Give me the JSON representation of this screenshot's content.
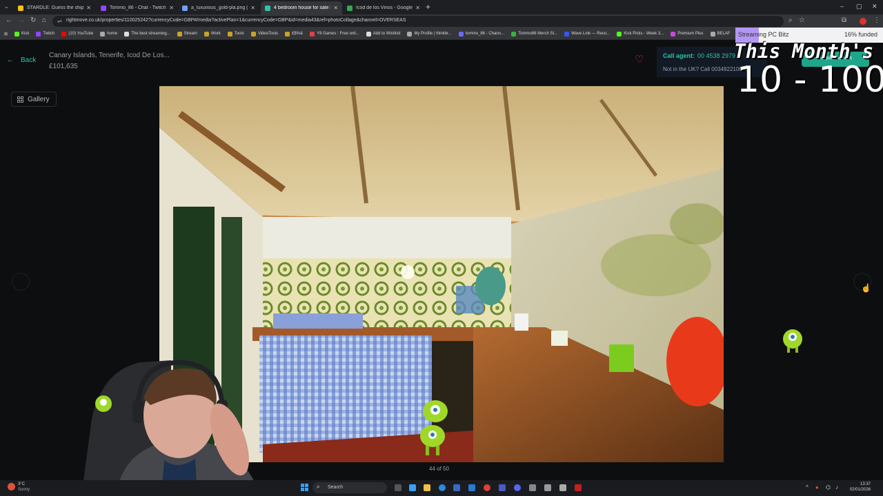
{
  "browser": {
    "tabs": [
      {
        "title": "STARDLE: Guess the ship!",
        "color": "#f0c419"
      },
      {
        "title": "Tommo_86 - Chat - Twitch",
        "color": "#9146ff"
      },
      {
        "title": "a_luxurious_gold-pla.png (960×",
        "color": "#6aa0ff"
      },
      {
        "title": "4 bedroom house for sale in Ca",
        "color": "#2dc5a6",
        "active": true
      },
      {
        "title": "Icod de los Vinos - Google Ma",
        "color": "#34a853"
      }
    ],
    "url": "rightmove.co.uk/properties/110025242?currencyCode=GBP#/media?activePlan=1&currencyCode=GBP&id=media43&ref=photoCollage&channel=OVERSEAS",
    "bookmarks": [
      {
        "label": "Kick",
        "color": "#53fc18"
      },
      {
        "label": "Twitch",
        "color": "#9146ff"
      },
      {
        "label": "(10) YouTube",
        "color": "#ff0000"
      },
      {
        "label": "home",
        "color": "#aaaaaa"
      },
      {
        "label": "The best streaming...",
        "color": "#dddddd"
      },
      {
        "label": "Stream",
        "color": "#c9a227"
      },
      {
        "label": "Work",
        "color": "#c9a227"
      },
      {
        "label": "Tools",
        "color": "#c9a227"
      },
      {
        "label": "VideoTools",
        "color": "#c9a227"
      },
      {
        "label": "£$%&",
        "color": "#c9a227"
      },
      {
        "label": "Y8 Games : Free onli...",
        "color": "#e04040"
      },
      {
        "label": "Add to Wishlist",
        "color": "#dddddd"
      },
      {
        "label": "My Profile | thinkbr...",
        "color": "#aaaaaa"
      },
      {
        "label": "tommo_86 - Chann...",
        "color": "#6a6aff"
      },
      {
        "label": "Tommo86 Merch St...",
        "color": "#3cb043"
      },
      {
        "label": "Wave Link — Reco...",
        "color": "#3355ff"
      },
      {
        "label": "Kick Picks - Week 3...",
        "color": "#53fc18"
      },
      {
        "label": "Premium Plus",
        "color": "#c64ad8"
      },
      {
        "label": "BELAF",
        "color": "#aaaaaa"
      }
    ]
  },
  "listing": {
    "back_label": "Back",
    "title": "Canary Islands, Tenerife, Icod De Los...",
    "price": "£101,635",
    "call_agent_label": "Call agent:",
    "call_agent_number": "00 4538 2979",
    "not_in_uk": "Not in the UK? Call 0034922106621",
    "request_label": "Request details",
    "gallery_label": "Gallery",
    "photo_counter": "44 of 50"
  },
  "stream_overlay": {
    "headline": "This Month's",
    "range": "10 - 100",
    "funding_label": "Streaming PC Bitz",
    "funding_pct": "16% funded",
    "funding_fraction": 0.16
  },
  "taskbar": {
    "weather_temp": "3°C",
    "weather_desc": "Sunny",
    "search_placeholder": "Search",
    "time": "13:37",
    "date": "02/01/2026"
  }
}
